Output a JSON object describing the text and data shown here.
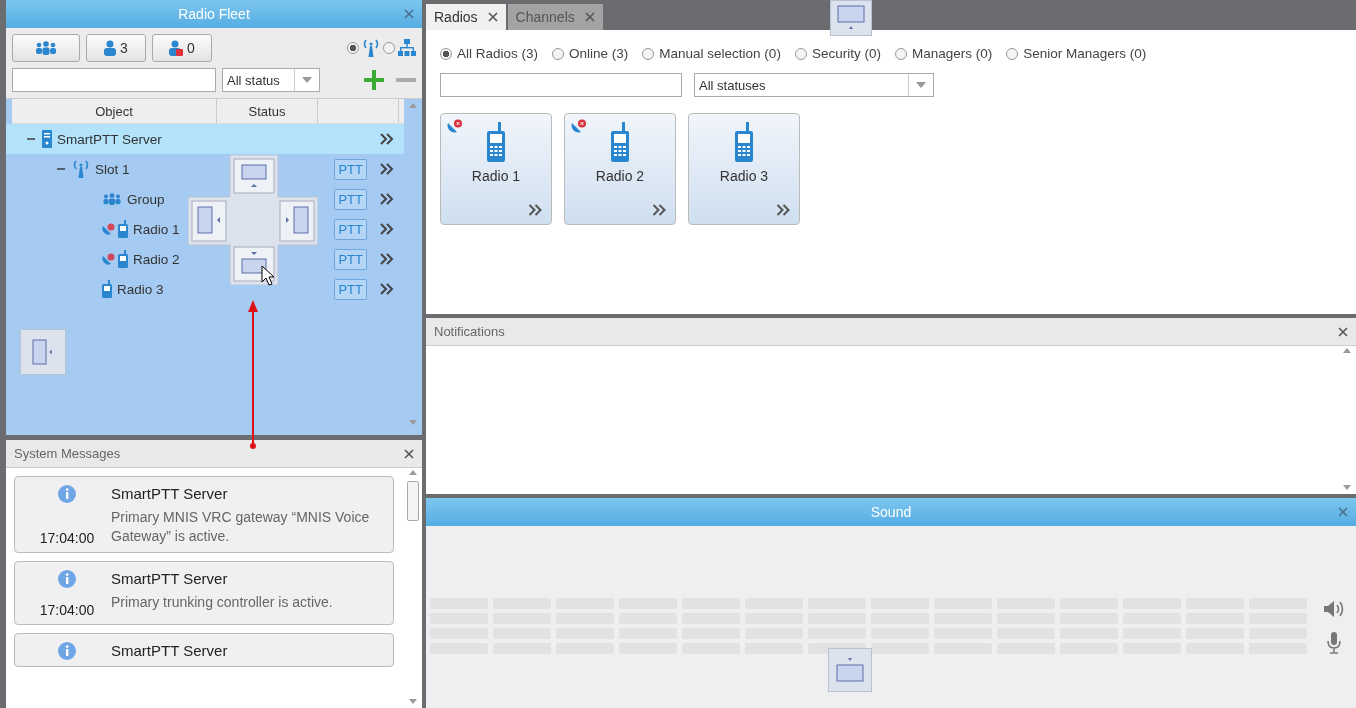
{
  "radio_fleet": {
    "title": "Radio Fleet",
    "filter_buttons": [
      {
        "kind": "groups"
      },
      {
        "kind": "users",
        "label": "3"
      },
      {
        "kind": "users-offline",
        "label": "0"
      }
    ],
    "view_options": [
      {
        "kind": "network",
        "selected": true
      },
      {
        "kind": "hierarchy",
        "selected": false
      }
    ],
    "status_filter": {
      "value": "All status"
    },
    "columns": [
      "Object",
      "Status"
    ],
    "tree": [
      {
        "kind": "server",
        "label": "SmartPTT Server",
        "expanded": true,
        "selected": true,
        "children": [
          {
            "kind": "slot",
            "label": "Slot 1",
            "expanded": true,
            "selected": false,
            "ptt": "PTT",
            "children": [
              {
                "kind": "group",
                "label": "Group",
                "selected": false,
                "alert": false,
                "ptt": "PTT"
              },
              {
                "kind": "radio",
                "label": "Radio 1",
                "selected": false,
                "alert": true,
                "ptt": "PTT"
              },
              {
                "kind": "radio",
                "label": "Radio 2",
                "selected": false,
                "alert": true,
                "ptt": "PTT"
              },
              {
                "kind": "radio",
                "label": "Radio 3",
                "selected": false,
                "alert": false,
                "ptt": "PTT"
              }
            ]
          }
        ]
      }
    ]
  },
  "system_messages": {
    "title": "System Messages",
    "messages": [
      {
        "source": "SmartPTT Server",
        "time": "17:04:00",
        "text": "Primary MNIS VRC gateway “MNIS Voice Gateway” is active."
      },
      {
        "source": "SmartPTT Server",
        "time": "17:04:00",
        "text": "Primary trunking controller is active."
      },
      {
        "source": "SmartPTT Server"
      }
    ]
  },
  "tabs": [
    {
      "label": "Radios",
      "selected": true
    },
    {
      "label": "Channels",
      "selected": false
    }
  ],
  "radios": {
    "filters": [
      {
        "label": "All Radios (3)",
        "selected": true
      },
      {
        "label": "Online (3)",
        "selected": false
      },
      {
        "label": "Manual selection (0)",
        "selected": false
      },
      {
        "label": "Security (0)",
        "selected": false
      },
      {
        "label": "Managers (0)",
        "selected": false
      },
      {
        "label": "Senior Managers (0)",
        "selected": false
      }
    ],
    "status_filter": {
      "value": "All statuses"
    },
    "cards": [
      {
        "name": "Radio 1",
        "alert": true
      },
      {
        "name": "Radio 2",
        "alert": true
      },
      {
        "name": "Radio 3",
        "alert": false
      }
    ]
  },
  "notifications": {
    "title": "Notifications"
  },
  "sound": {
    "title": "Sound"
  }
}
